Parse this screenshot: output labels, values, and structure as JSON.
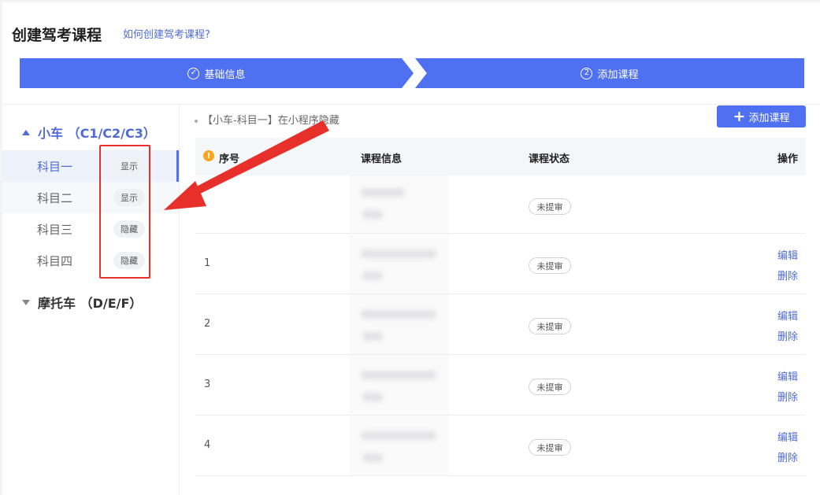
{
  "header": {
    "title": "创建驾考课程",
    "help_link": "如何创建驾考课程?"
  },
  "steps": [
    {
      "index": "✓",
      "label": "基础信息"
    },
    {
      "index": "2",
      "label": "添加课程"
    }
  ],
  "sidebar": {
    "groups": [
      {
        "label": "小车 （C1/C2/C3）",
        "expanded": true
      },
      {
        "label": "摩托车 （D/E/F）",
        "expanded": false
      }
    ],
    "subjects": [
      {
        "label": "科目一",
        "badge": "显示",
        "active": true
      },
      {
        "label": "科目二",
        "badge": "显示",
        "active": false
      },
      {
        "label": "科目三",
        "badge": "隐藏",
        "active": false
      },
      {
        "label": "科目四",
        "badge": "隐藏",
        "active": false
      }
    ]
  },
  "main": {
    "hint": "【小车-科目一】在小程序隐藏",
    "add_button": "添加课程",
    "table": {
      "headers": {
        "index": "序号",
        "info": "课程信息",
        "status": "课程状态",
        "ops": "操作"
      },
      "rows": [
        {
          "index": "",
          "status": "未提审",
          "edit": "",
          "delete": ""
        },
        {
          "index": "1",
          "status": "未提审",
          "edit": "编辑",
          "delete": "删除"
        },
        {
          "index": "2",
          "status": "未提审",
          "edit": "编辑",
          "delete": "删除"
        },
        {
          "index": "3",
          "status": "未提审",
          "edit": "编辑",
          "delete": "删除"
        },
        {
          "index": "4",
          "status": "未提审",
          "edit": "编辑",
          "delete": "删除"
        }
      ]
    }
  },
  "colors": {
    "accent": "#4f70f0",
    "annotation": "#e8302a",
    "warning": "#f5a623"
  }
}
